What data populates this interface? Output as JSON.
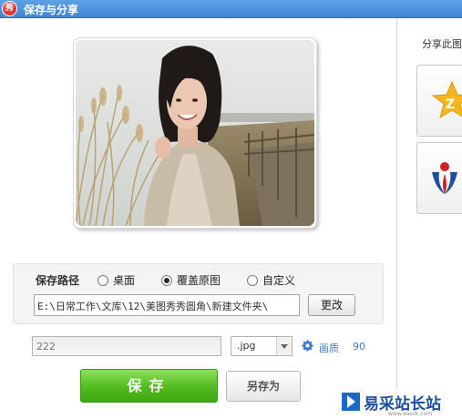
{
  "window": {
    "title": "保存与分享",
    "app_icon": "meitu-xiuxiu-icon",
    "app_icon_glyph": "秀"
  },
  "preview": {
    "image": "portrait-photo-rounded-corners"
  },
  "save_settings": {
    "path_label": "保存路径",
    "location_options": [
      {
        "label": "桌面",
        "selected": false
      },
      {
        "label": "覆盖原图",
        "selected": true
      },
      {
        "label": "自定义",
        "selected": false
      }
    ],
    "path_value": "E:\\日常工作\\文库\\12\\美图秀秀圆角\\新建文件夹\\",
    "change_button": "更改"
  },
  "file": {
    "name_value": "222",
    "extension": ".jpg",
    "quality_icon": "gear-icon",
    "quality_label": "画质",
    "quality_value": "90"
  },
  "actions": {
    "save": "保存",
    "save_as": "另存为"
  },
  "share": {
    "title": "分享此图",
    "targets": [
      {
        "icon": "qzone-icon"
      },
      {
        "icon": "renren-icon"
      }
    ]
  },
  "watermark": {
    "text": "易采站长站",
    "subtext": "www.easck.com"
  },
  "colors": {
    "titlebar": "#4a90dd",
    "save_button": "#4fbb1e",
    "link": "#3d7bd0"
  }
}
